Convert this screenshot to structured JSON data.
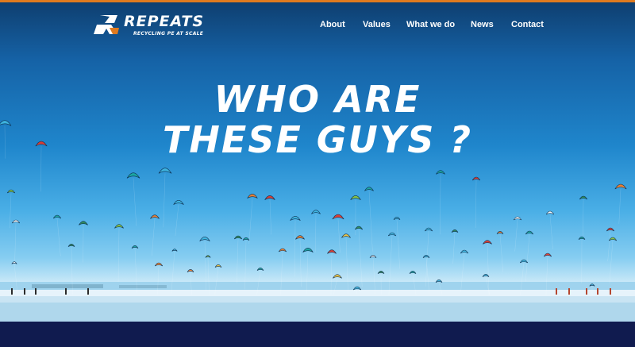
{
  "brand": {
    "name": "REPEATS",
    "tagline": "RECYCLING PE AT SCALE"
  },
  "nav": {
    "items": [
      {
        "label": "About"
      },
      {
        "label": "Values"
      },
      {
        "label": "What we do"
      },
      {
        "label": "News"
      },
      {
        "label": "Contact"
      }
    ]
  },
  "hero": {
    "headline_line1": "WHO ARE",
    "headline_line2": "THESE GUYS ?",
    "image": "kitesurfers-beach"
  },
  "colors": {
    "accent": "#e07a1f",
    "footer_band": "#101b4f",
    "text": "#ffffff"
  }
}
